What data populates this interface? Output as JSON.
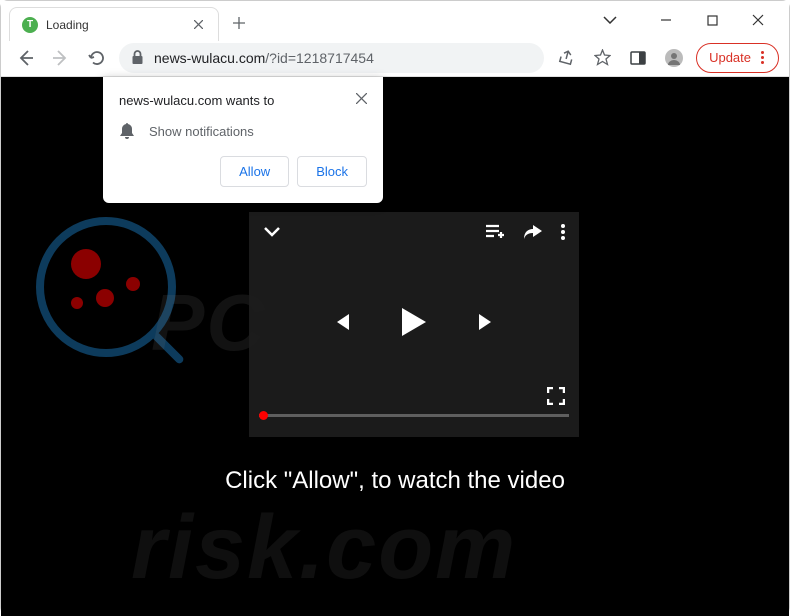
{
  "tab": {
    "title": "Loading",
    "favicon_letter": "T"
  },
  "omnibox": {
    "url_domain": "news-wulacu.com",
    "url_path": "/?id=1218717454"
  },
  "toolbar": {
    "update_label": "Update"
  },
  "permission_dialog": {
    "title": "news-wulacu.com wants to",
    "body": "Show notifications",
    "allow_label": "Allow",
    "block_label": "Block"
  },
  "page": {
    "instruction": "Click \"Allow\", to watch the video",
    "watermark1": "PC",
    "watermark2": "risk.com"
  }
}
